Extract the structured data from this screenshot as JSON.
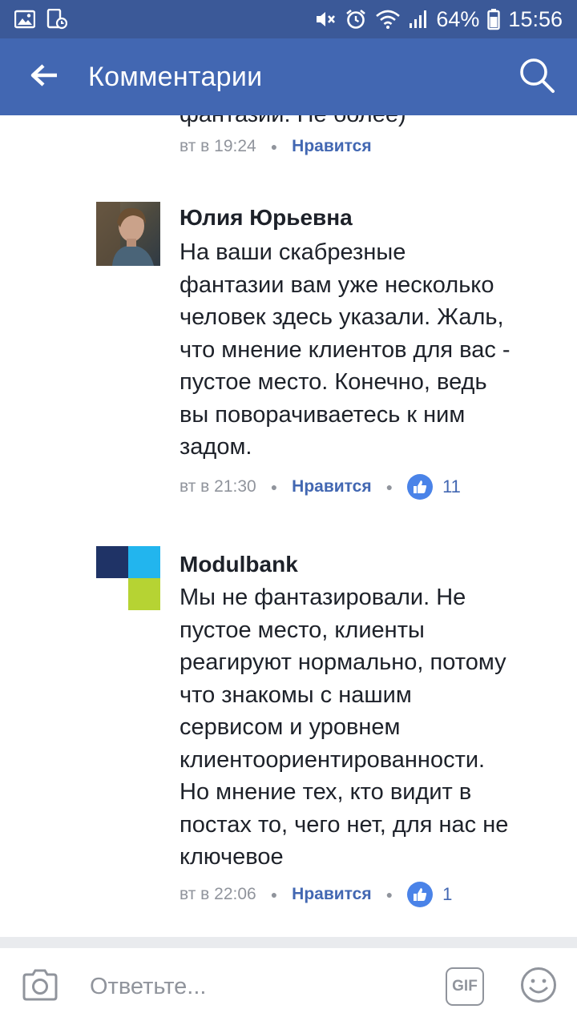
{
  "status_bar": {
    "battery": "64%",
    "time": "15:56",
    "icons": [
      "gallery-icon",
      "screenshot-icon",
      "mute-icon",
      "alarm-icon",
      "wifi-icon",
      "signal-icon",
      "battery-icon"
    ]
  },
  "header": {
    "title": "Комментарии",
    "back_icon": "arrow-left-icon",
    "search_icon": "search-icon"
  },
  "comments": {
    "partial": {
      "text_tail": "фантазии. Не более)",
      "time": "вт в 19:24",
      "like_label": "Нравится"
    },
    "items": [
      {
        "author": "Юлия Юрьевна",
        "lines": [
          "На ваши скабрезные",
          "фантазии вам уже несколько",
          "человек здесь указали. Жаль,",
          "что мнение клиентов для вас -",
          "пустое место. Конечно, ведь",
          "вы поворачиваетесь к ним",
          "задом."
        ],
        "time": "вт в 21:30",
        "like_label": "Нравится",
        "likes": "11"
      },
      {
        "author": "Modulbank",
        "lines": [
          "Мы не фантазировали. Не",
          "пустое место, клиенты",
          "реагируют нормально, потому",
          "что знакомы с нашим",
          "сервисом и уровнем",
          "клиентоориентированности.",
          "Но мнение тех, кто видит в",
          "постах то, чего нет, для нас не",
          "ключевое"
        ],
        "time": "вт в 22:06",
        "like_label": "Нравится",
        "likes": "1"
      }
    ]
  },
  "composer": {
    "placeholder": "Ответьте...",
    "gif_label": "GIF"
  },
  "colors": {
    "status_bar": "#3b5998",
    "app_bar": "#4267b2",
    "like_badge": "#4a83e8",
    "meta_text": "#90949c",
    "modulbank_navy": "#1f3366",
    "modulbank_cyan": "#22b5ee",
    "modulbank_lime": "#b6d333"
  }
}
